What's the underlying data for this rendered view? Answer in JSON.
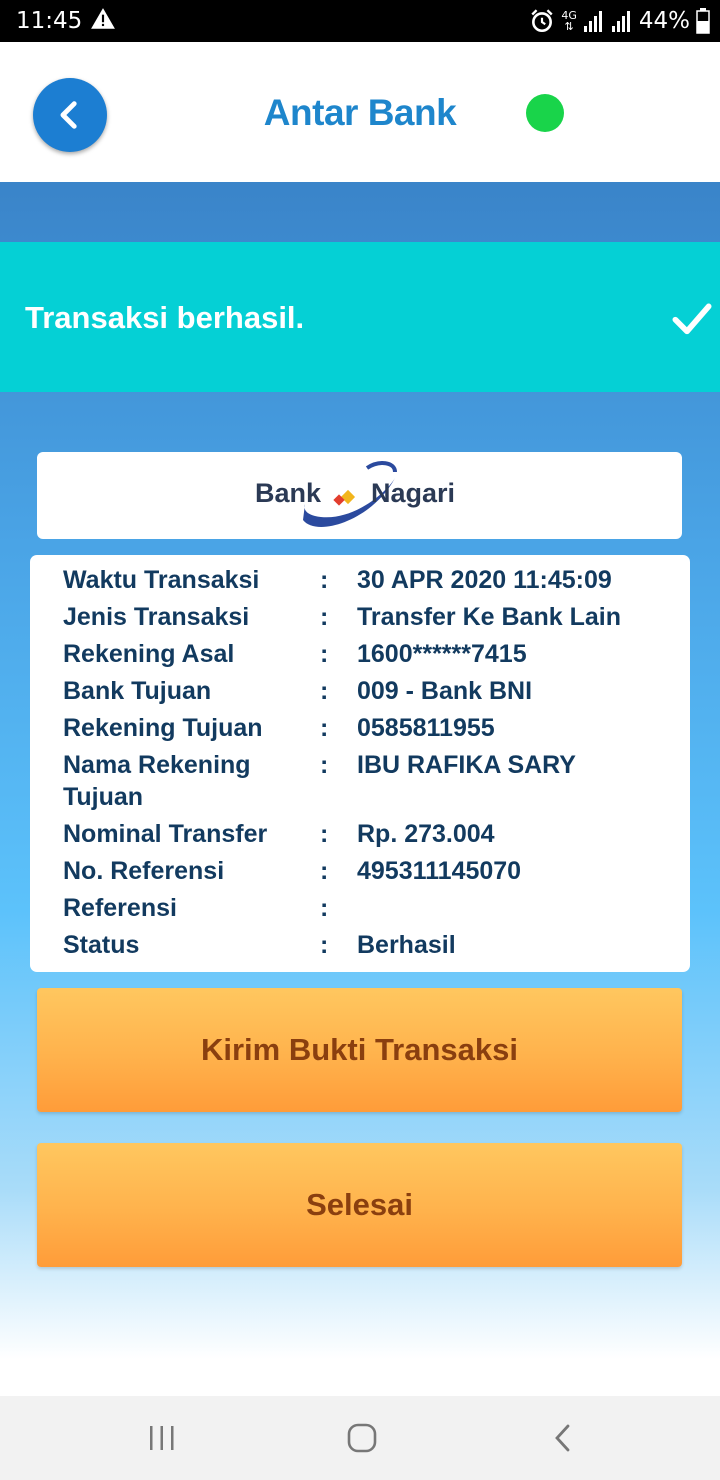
{
  "status_bar": {
    "time": "11:45",
    "network": "4G",
    "battery": "44%"
  },
  "header": {
    "title": "Antar Bank",
    "back_icon": "chevron-left-icon",
    "status_color": "#19d44a"
  },
  "banner": {
    "message": "Transaksi berhasil.",
    "icon": "check-icon",
    "color": "#05d0d5"
  },
  "logo": {
    "left_text": "Bank",
    "right_text": "Nagari"
  },
  "details": [
    {
      "label": "Waktu Transaksi",
      "sep": ":",
      "value": "30 APR 2020 11:45:09"
    },
    {
      "label": "Jenis Transaksi",
      "sep": ":",
      "value": "Transfer Ke Bank Lain"
    },
    {
      "label": "Rekening Asal",
      "sep": ":",
      "value": "1600******7415"
    },
    {
      "label": "Bank Tujuan",
      "sep": ":",
      "value": "009 - Bank BNI"
    },
    {
      "label": "Rekening Tujuan",
      "sep": ":",
      "value": "0585811955"
    },
    {
      "label": "Nama Rekening Tujuan",
      "sep": ":",
      "value": "IBU RAFIKA  SARY"
    },
    {
      "label": "Nominal Transfer",
      "sep": ":",
      "value": "Rp. 273.004"
    },
    {
      "label": "No. Referensi",
      "sep": ":",
      "value": "495311145070"
    },
    {
      "label": "Referensi",
      "sep": ":",
      "value": ""
    },
    {
      "label": "Status",
      "sep": ":",
      "value": "Berhasil"
    }
  ],
  "actions": {
    "send_proof": "Kirim Bukti Transaksi",
    "done": "Selesai"
  },
  "nav": {
    "recents_icon": "recents-icon",
    "home_icon": "home-icon",
    "back_icon": "back-icon"
  }
}
